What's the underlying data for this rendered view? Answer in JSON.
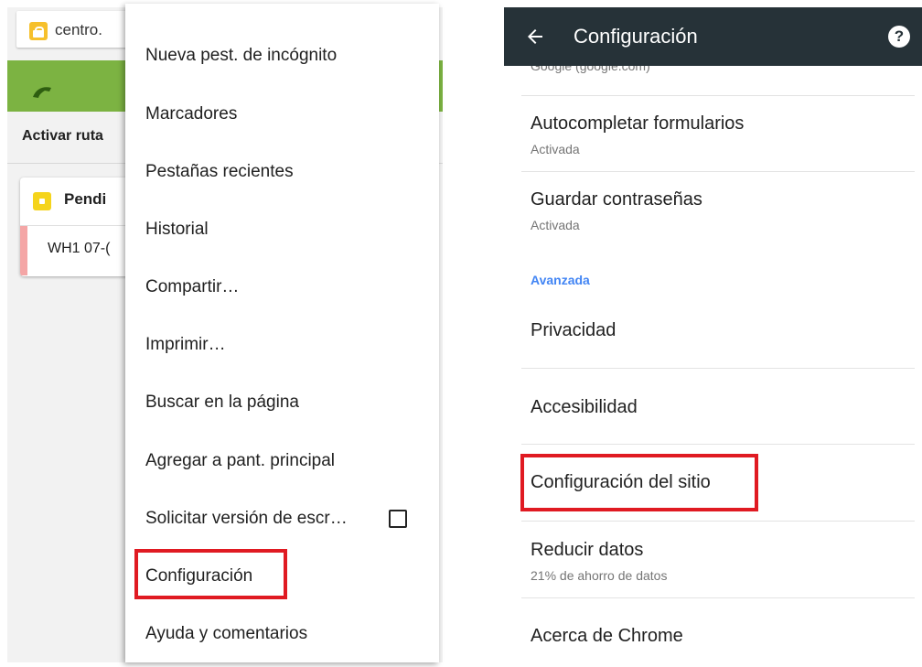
{
  "browser": {
    "url_text": "centro."
  },
  "background_page": {
    "route_label": "Activar ruta",
    "card_title": "Pendi",
    "card_row": "WH1 07-("
  },
  "menu": {
    "items": [
      "Nueva pest. de incógnito",
      "Marcadores",
      "Pestañas recientes",
      "Historial",
      "Compartir…",
      "Imprimir…",
      "Buscar en la página",
      "Agregar a pant. principal",
      "Solicitar versión de escr…",
      "Configuración",
      "Ayuda y comentarios"
    ],
    "desktop_checkbox_checked": false
  },
  "settings": {
    "title": "Configuración",
    "help_glyph": "?",
    "previous_subtitle": "Google (google.com)",
    "items": [
      {
        "title": "Autocompletar formularios",
        "subtitle": "Activada"
      },
      {
        "title": "Guardar contraseñas",
        "subtitle": "Activada"
      }
    ],
    "advanced_header": "Avanzada",
    "advanced_items": [
      {
        "title": "Privacidad"
      },
      {
        "title": "Accesibilidad"
      },
      {
        "title": "Configuración del sitio"
      },
      {
        "title": "Reducir datos",
        "subtitle": "21% de ahorro de datos"
      },
      {
        "title": "Acerca de Chrome"
      }
    ]
  },
  "colors": {
    "highlight": "#e01a22",
    "toolbar_green": "#7cb342",
    "settings_appbar": "#263238",
    "section_header": "#4285f4"
  }
}
